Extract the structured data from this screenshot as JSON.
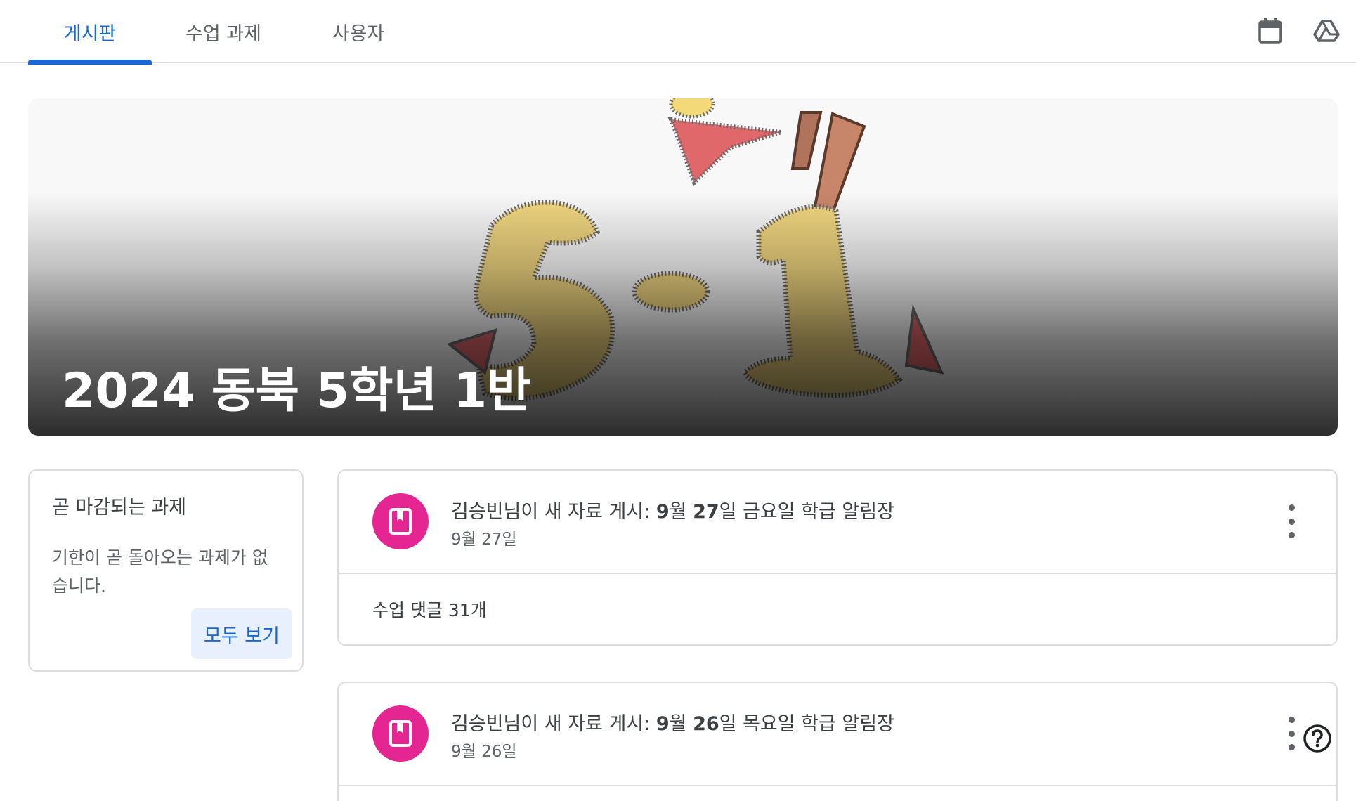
{
  "tabs": [
    {
      "label": "게시판",
      "active": true
    },
    {
      "label": "수업 과제",
      "active": false
    },
    {
      "label": "사용자",
      "active": false
    }
  ],
  "top_icons": [
    "calendar-icon",
    "google-drive-icon"
  ],
  "banner": {
    "title": "2024 동북 5학년 1반"
  },
  "upcoming": {
    "title": "곧 마감되는 과제",
    "empty_text": "기한이 곧 돌아오는 과제가 없습니다.",
    "view_all_label": "모두 보기"
  },
  "posts": [
    {
      "author_prefix": "김승빈님이 새 자료 게시: ",
      "title_bold_1": "9",
      "title_mid_1": "월 ",
      "title_bold_2": "27",
      "title_rest": "일 금요일 학급 알림장",
      "date": "9월 27일",
      "comments": "수업 댓글 31개",
      "icon": "material-book-icon"
    },
    {
      "author_prefix": "김승빈님이 새 자료 게시: ",
      "title_bold_1": "9",
      "title_mid_1": "월 ",
      "title_bold_2": "26",
      "title_rest": "일 목요일 학급 알림장",
      "date": "9월 26일",
      "icon": "material-book-icon"
    }
  ],
  "colors": {
    "accent": "#1967d2",
    "material_pink": "#e52592",
    "border": "#dadce0"
  }
}
